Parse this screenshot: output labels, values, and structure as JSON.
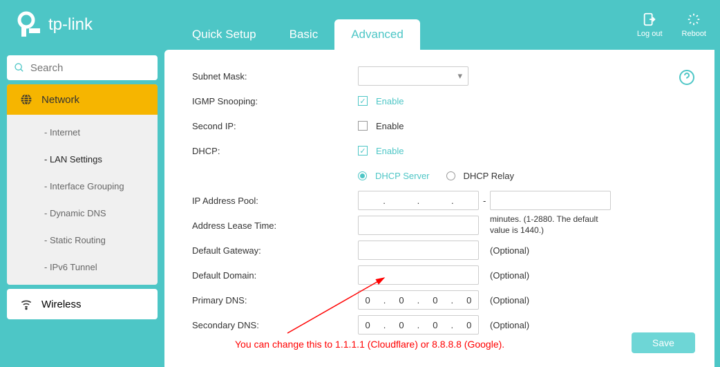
{
  "header": {
    "brand": "tp-link",
    "tabs": {
      "quick": "Quick Setup",
      "basic": "Basic",
      "advanced": "Advanced"
    },
    "logout": "Log out",
    "reboot": "Reboot"
  },
  "search": {
    "placeholder": "Search"
  },
  "sidebar": {
    "network": {
      "label": "Network",
      "items": [
        "- Internet",
        "- LAN Settings",
        "- Interface Grouping",
        "- Dynamic DNS",
        "- Static Routing",
        "- IPv6 Tunnel"
      ]
    },
    "wireless": {
      "label": "Wireless"
    }
  },
  "form": {
    "subnet_mask": "Subnet Mask:",
    "igmp": {
      "label": "IGMP Snooping:",
      "enable": "Enable"
    },
    "second_ip": {
      "label": "Second IP:",
      "enable": "Enable"
    },
    "dhcp": {
      "label": "DHCP:",
      "enable": "Enable",
      "server": "DHCP Server",
      "relay": "DHCP Relay"
    },
    "pool": {
      "label": "IP Address Pool:",
      "dash": "-"
    },
    "lease": {
      "label": "Address Lease Time:",
      "note": "minutes. (1-2880. The default value is 1440.)"
    },
    "gateway": {
      "label": "Default Gateway:",
      "opt": "(Optional)"
    },
    "domain": {
      "label": "Default Domain:",
      "opt": "(Optional)"
    },
    "pdns": {
      "label": "Primary DNS:",
      "opt": "(Optional)",
      "ip": [
        "0",
        "0",
        "0",
        "0"
      ]
    },
    "sdns": {
      "label": "Secondary DNS:",
      "opt": "(Optional)",
      "ip": [
        "0",
        "0",
        "0",
        "0"
      ]
    },
    "save": "Save"
  },
  "annotation": "You can change this to 1.1.1.1 (Cloudflare) or 8.8.8.8 (Google)."
}
